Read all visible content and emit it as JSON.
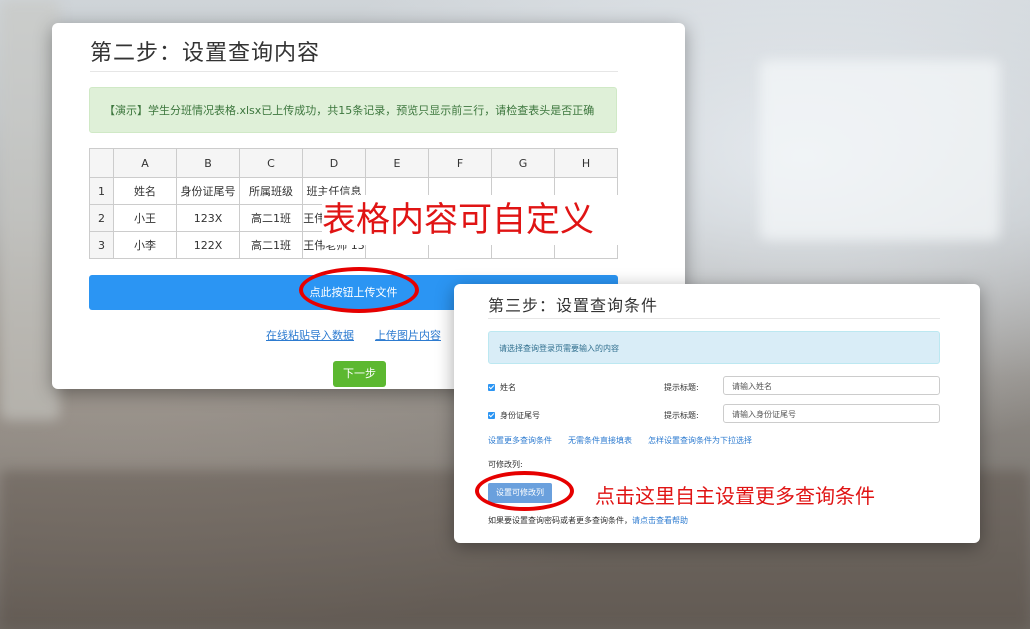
{
  "step2": {
    "title": "第二步：设置查询内容",
    "alert": "【演示】学生分班情况表格.xlsx已上传成功，共15条记录，预览只显示前三行，请检查表头是否正确",
    "sheet": {
      "columns": [
        "A",
        "B",
        "C",
        "D",
        "E",
        "F",
        "G",
        "H"
      ],
      "rows": [
        {
          "num": "1",
          "cells": [
            "姓名",
            "身份证尾号",
            "所属班级",
            "班主任信息",
            "",
            "",
            "",
            ""
          ]
        },
        {
          "num": "2",
          "cells": [
            "小王",
            "123X",
            "高二1班",
            "王伟老师 13",
            "",
            "",
            "",
            ""
          ]
        },
        {
          "num": "3",
          "cells": [
            "小李",
            "122X",
            "高二1班",
            "王伟老师 13",
            "",
            "",
            "",
            ""
          ]
        }
      ]
    },
    "overlay_text": "表格内容可自定义",
    "upload_button": "点此按钮上传文件",
    "paste_link": "在线粘贴导入数据",
    "image_link": "上传图片内容",
    "next_button": "下一步"
  },
  "step3": {
    "title": "第三步：设置查询条件",
    "info": "请选择查询登录页需要输入的内容",
    "fields": [
      {
        "label": "姓名",
        "checked": true,
        "hint_label": "提示标题:",
        "placeholder": "请输入姓名"
      },
      {
        "label": "身份证尾号",
        "checked": true,
        "hint_label": "提示标题:",
        "placeholder": "请输入身份证尾号"
      }
    ],
    "links": [
      "设置更多查询条件",
      "无需条件直接填表",
      "怎样设置查询条件为下拉选择"
    ],
    "editable_label": "可修改列:",
    "edit_button": "设置可修改列",
    "help_prefix": "如果要设置查询密码或者更多查询条件，",
    "help_link": "请点击查看帮助",
    "annotation": "点击这里自主设置更多查询条件"
  },
  "colors": {
    "primary": "#2b95f3",
    "success": "#5cb830",
    "annotation_red": "#e01414"
  }
}
